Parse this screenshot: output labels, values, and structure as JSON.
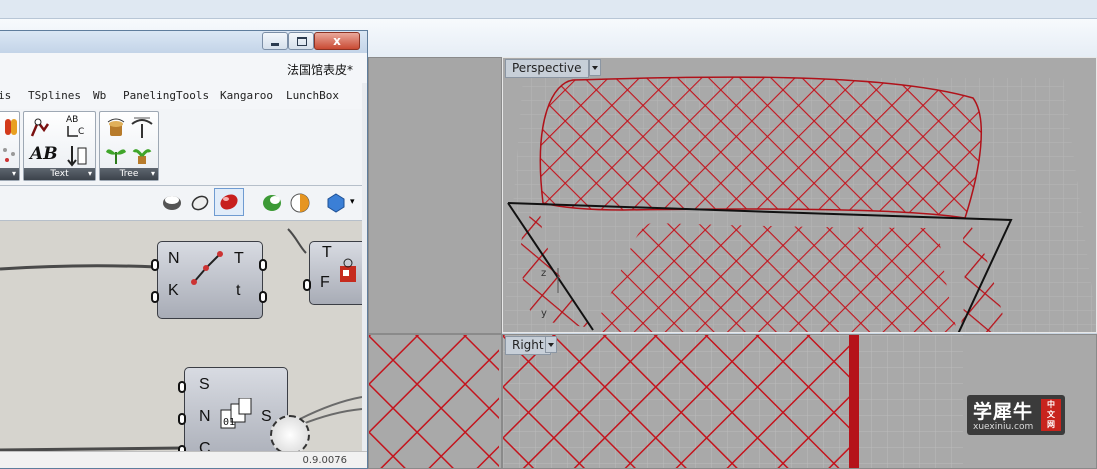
{
  "gh": {
    "close_label": "x",
    "doc_title": "法国馆表皮*",
    "tabs": [
      "is",
      "TSplines",
      "Wb",
      "PanelingTools",
      "Kangaroo",
      "LunchBox"
    ],
    "ribbon": {
      "text_panel": "Text",
      "tree_panel": "Tree",
      "ab_top": "AB",
      "ab_sub": "C",
      "ab_italic": "AB"
    },
    "components": {
      "curve_params": {
        "inputs": [
          "N",
          "K"
        ],
        "outputs": [
          "T",
          "t"
        ]
      },
      "split": {
        "inputs": [
          "S",
          "N",
          "C"
        ],
        "outputs": [
          "S"
        ]
      },
      "partial": {
        "inputs": [
          "F"
        ],
        "outputs": [
          "T"
        ]
      }
    },
    "version": "0.9.0076"
  },
  "viewports": {
    "perspective": "Perspective",
    "right": "Right"
  },
  "axes": {
    "z": "z",
    "y": "y"
  },
  "watermark": {
    "title": "学犀牛",
    "url": "xuexiniu.com",
    "badge": [
      "中",
      "文",
      "网"
    ]
  }
}
